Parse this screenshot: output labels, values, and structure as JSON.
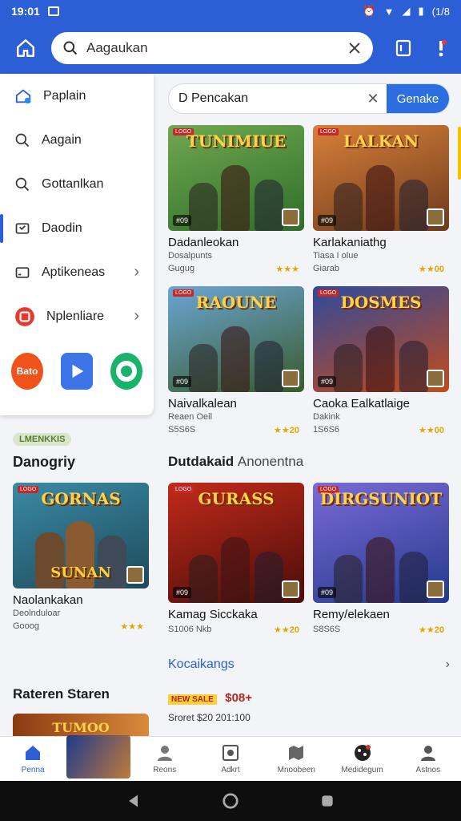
{
  "status_bar": {
    "time": "19:01",
    "battery": "(1/8"
  },
  "app_bar": {
    "search_value": "Aagaukan"
  },
  "sidebar": {
    "items": [
      {
        "label": "Paplain",
        "icon": "home-badge-icon"
      },
      {
        "label": "Aagain",
        "icon": "search-icon"
      },
      {
        "label": "Gottanlkan",
        "icon": "search-icon"
      },
      {
        "label": "Daodin",
        "icon": "gamepad-icon"
      },
      {
        "label": "Aptikeneas",
        "icon": "window-icon"
      },
      {
        "label": "Nplenliare",
        "icon": "app-red-icon"
      }
    ],
    "app_tiles": [
      {
        "label": "Bato",
        "color": "#f0521b"
      },
      {
        "label": "",
        "color": "#3d74e8"
      },
      {
        "label": "",
        "color": "#1ab36b"
      }
    ]
  },
  "left_lower": {
    "tag": "LMENKKIS",
    "section1_title": "Danogriy",
    "card": {
      "logo": "GORNAS",
      "logo2": "SUNAN",
      "name": "Naolankakan",
      "sub": "Deolnduloar",
      "meta": "Gooog",
      "stars": "★★★"
    },
    "section2_title": "Rateren Staren",
    "card2": {
      "logo": "TUMOO"
    }
  },
  "main": {
    "search_value": "D Pencakan",
    "search_button": "Genake",
    "cards": [
      {
        "logo": "TUNIMIUE",
        "rank": "#09",
        "name": "Dadanleokan",
        "sub": "Dosalpunts",
        "meta": "Gugug",
        "stars": "★★★",
        "bg": [
          "#6fa84f",
          "#2f6e2a"
        ]
      },
      {
        "logo": "LALKAN",
        "rank": "#09",
        "name": "Karlakaniathg",
        "sub": "Tiasa I olue",
        "meta": "Giarab",
        "stars": "★★00",
        "bg": [
          "#d9803a",
          "#6d3a1c"
        ]
      },
      {
        "logo": "RAOUNE",
        "rank": "#09",
        "name": "Naivalkalean",
        "sub": "Reaen Oeil",
        "meta": "S5S6S",
        "stars": "★★20",
        "bg": [
          "#6aa6d6",
          "#3a5a2a"
        ]
      },
      {
        "logo": "DOSMES",
        "rank": "#09",
        "name": "Caoka Ealkatlaige",
        "sub": "Dakink",
        "meta": "1S6S6",
        "stars": "★★00",
        "bg": [
          "#2e4a9c",
          "#c54a1a"
        ]
      },
      {
        "logo": "GURASS",
        "rank": "#09",
        "name": "Kamag Sicckaka",
        "sub": "",
        "meta": "S1006 Nkb",
        "stars": "★★20",
        "bg": [
          "#c22a1a",
          "#4a0d0a"
        ]
      },
      {
        "logo": "DIRGSUNIOT",
        "rank": "#09",
        "name": "Remy/elekaen",
        "sub": "",
        "meta": "S8S6S",
        "stars": "★★20",
        "bg": [
          "#7a6ad8",
          "#243a8c"
        ]
      }
    ],
    "section_title": "Dutdakaid",
    "section_title_light": "Anonentna",
    "link": "Kocaikangs",
    "promo": {
      "badge": "NEW SALE",
      "price": "$08+",
      "line": "Sroret $20 201:100"
    }
  },
  "bottom_nav": [
    {
      "label": "Penna",
      "icon": "home-icon",
      "active": true
    },
    {
      "label": "",
      "icon": "game-promo-icon",
      "active": false
    },
    {
      "label": "Reons",
      "icon": "person-icon",
      "active": false
    },
    {
      "label": "Adkrt",
      "icon": "device-icon",
      "active": false
    },
    {
      "label": "Mnoobeen",
      "icon": "map-icon",
      "active": false
    },
    {
      "label": "Medidegum",
      "icon": "dice-icon",
      "active": false
    },
    {
      "label": "Astnos",
      "icon": "account-icon",
      "active": false
    }
  ]
}
